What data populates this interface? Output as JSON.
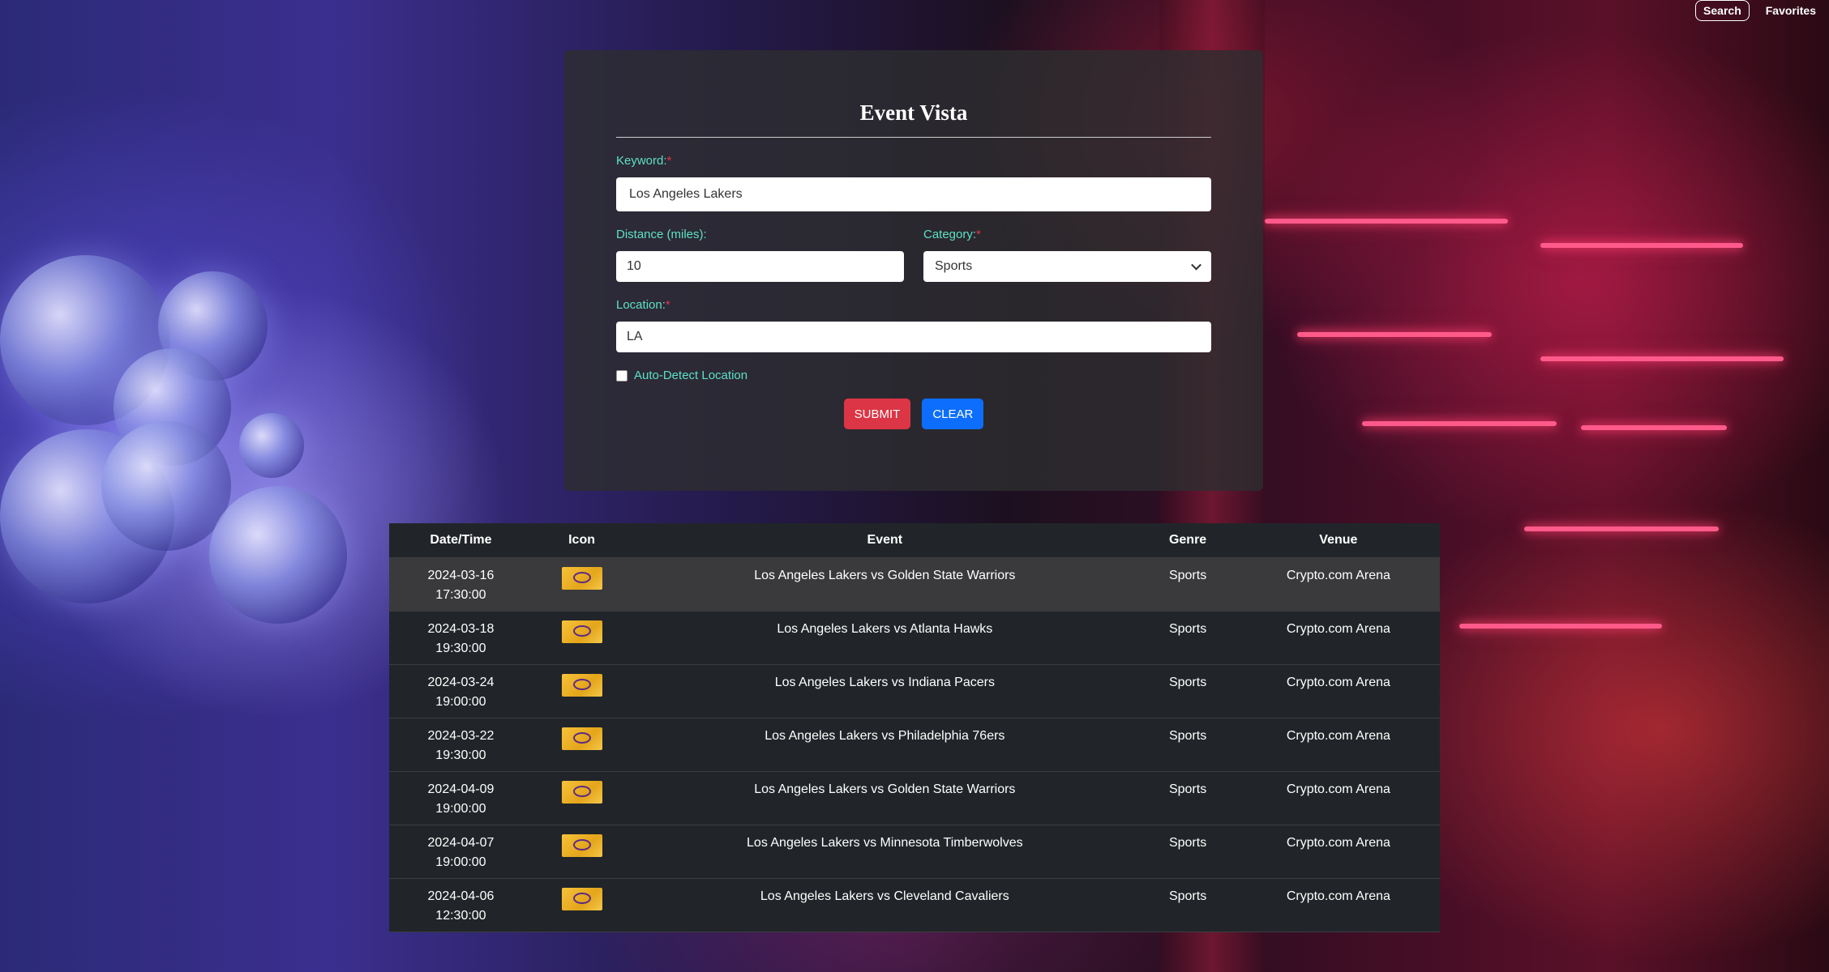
{
  "nav": {
    "search": "Search",
    "favorites": "Favorites"
  },
  "form": {
    "title": "Event Vista",
    "keyword_label": "Keyword:",
    "keyword_value": "Los Angeles Lakers",
    "distance_label": "Distance (miles):",
    "distance_value": "10",
    "category_label": "Category:",
    "category_value": "Sports",
    "location_label": "Location:",
    "location_value": "LA",
    "required_mark": "*",
    "auto_detect_label": "Auto-Detect Location",
    "auto_detect_checked": false,
    "submit_label": "SUBMIT",
    "clear_label": "CLEAR"
  },
  "table": {
    "headers": [
      "Date/Time",
      "Icon",
      "Event",
      "Genre",
      "Venue"
    ],
    "rows": [
      {
        "date": "2024-03-16",
        "time": "17:30:00",
        "event": "Los Angeles Lakers vs Golden State Warriors",
        "genre": "Sports",
        "venue": "Crypto.com Arena"
      },
      {
        "date": "2024-03-18",
        "time": "19:30:00",
        "event": "Los Angeles Lakers vs Atlanta Hawks",
        "genre": "Sports",
        "venue": "Crypto.com Arena"
      },
      {
        "date": "2024-03-24",
        "time": "19:00:00",
        "event": "Los Angeles Lakers vs Indiana Pacers",
        "genre": "Sports",
        "venue": "Crypto.com Arena"
      },
      {
        "date": "2024-03-22",
        "time": "19:30:00",
        "event": "Los Angeles Lakers vs Philadelphia 76ers",
        "genre": "Sports",
        "venue": "Crypto.com Arena"
      },
      {
        "date": "2024-04-09",
        "time": "19:00:00",
        "event": "Los Angeles Lakers vs Golden State Warriors",
        "genre": "Sports",
        "venue": "Crypto.com Arena"
      },
      {
        "date": "2024-04-07",
        "time": "19:00:00",
        "event": "Los Angeles Lakers vs Minnesota Timberwolves",
        "genre": "Sports",
        "venue": "Crypto.com Arena"
      },
      {
        "date": "2024-04-06",
        "time": "12:30:00",
        "event": "Los Angeles Lakers vs Cleveland Cavaliers",
        "genre": "Sports",
        "venue": "Crypto.com Arena"
      }
    ]
  },
  "colors": {
    "accent_label": "#5ee0c6",
    "submit": "#dc3545",
    "clear": "#0d6efd",
    "table_bg": "#212529"
  },
  "icons": {
    "row_icon": "lakers-logo-icon",
    "select_icon": "chevron-down-icon"
  }
}
